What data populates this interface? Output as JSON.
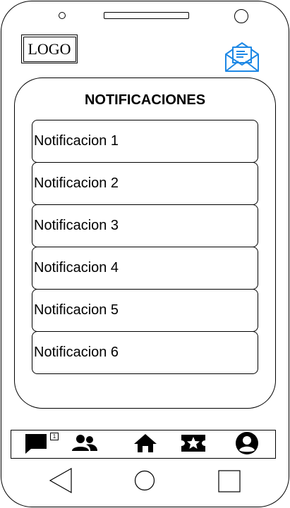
{
  "header": {
    "logo_text": "LOGO",
    "mail_icon": "envelope-open-icon",
    "accent_color": "#1e88e5"
  },
  "panel": {
    "title": "NOTIFICACIONES",
    "items": [
      {
        "label": "Notificacion 1"
      },
      {
        "label": "Notificacion 2"
      },
      {
        "label": "Notificacion 3"
      },
      {
        "label": "Notificacion 4"
      },
      {
        "label": "Notificacion 5"
      },
      {
        "label": "Notificacion 6"
      }
    ]
  },
  "bottom_nav": {
    "items": [
      {
        "icon": "chat-icon",
        "badge": "1"
      },
      {
        "icon": "people-icon"
      },
      {
        "icon": "home-icon"
      },
      {
        "icon": "ticket-star-icon"
      },
      {
        "icon": "account-icon"
      }
    ]
  },
  "system_nav": {
    "items": [
      "back-icon",
      "home-circle-icon",
      "recents-icon"
    ]
  }
}
